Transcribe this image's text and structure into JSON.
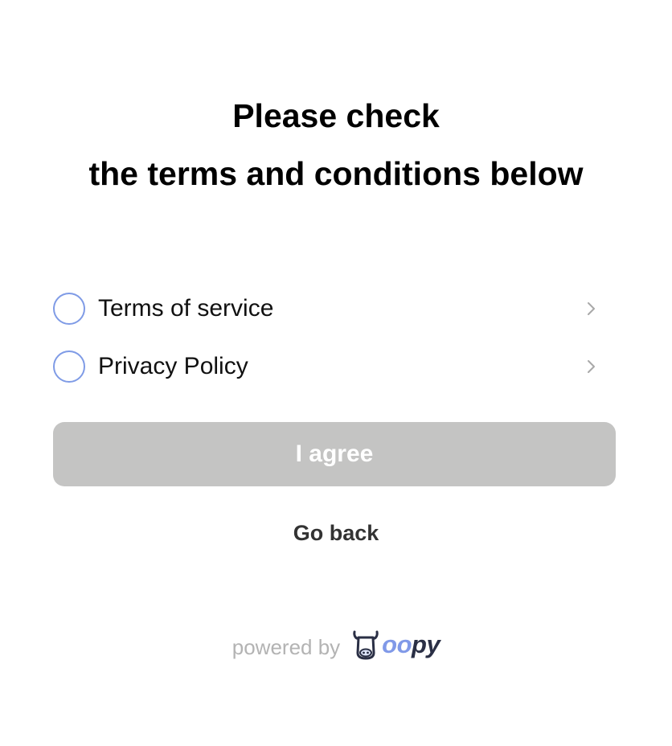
{
  "header": {
    "title_line1": "Please check",
    "title_line2": "the terms and conditions below"
  },
  "terms": [
    {
      "label": "Terms of service",
      "checked": false,
      "icon": "chevron-right-icon"
    },
    {
      "label": "Privacy Policy",
      "checked": false,
      "icon": "chevron-right-icon"
    }
  ],
  "actions": {
    "agree_label": "I agree",
    "agree_disabled": true,
    "back_label": "Go back"
  },
  "footer": {
    "powered_by": "powered by",
    "logo_text": "oopy",
    "logo_text_accent": "oo",
    "logo_text_rest": "py"
  },
  "colors": {
    "accent": "#7f9be6",
    "disabled_button": "#c4c4c3",
    "logo_dark": "#2a2f45",
    "muted_text": "#b3b3b3"
  }
}
